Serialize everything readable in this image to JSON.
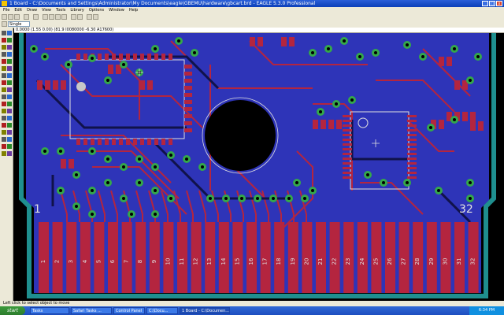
{
  "window": {
    "title": "1 Board - C:\\Documents and Settings\\Administrator\\My Documents\\eagle\\GBEMU\\hardware\\gbcart.brd - EAGLE 5.3.0 Professional",
    "min": "_",
    "max": "□",
    "close": "x"
  },
  "menu": [
    "File",
    "Edit",
    "Draw",
    "View",
    "Tools",
    "Library",
    "Options",
    "Window",
    "Help"
  ],
  "toolbar": {
    "layer_field": "1 Top",
    "grid_field": "Single"
  },
  "coord_readout": "0.0000 (1.55 0.00) (81.9 I0080000 -6.30 A17600)",
  "board": {
    "pad_label_left": "1",
    "pad_label_right": "32",
    "edge_pads": [
      "1",
      "2",
      "3",
      "4",
      "5",
      "6",
      "7",
      "8",
      "9",
      "10",
      "11",
      "12",
      "13",
      "14",
      "15",
      "16",
      "17",
      "18",
      "19",
      "20",
      "21",
      "22",
      "23",
      "24",
      "25",
      "26",
      "27",
      "28",
      "29",
      "30",
      "31",
      "32"
    ],
    "colors": {
      "background": "#000000",
      "top_copper": "#b4253f",
      "bottom_copper": "#2e34b8",
      "via": "#34a84a",
      "outline": "#1f8f8f",
      "silk": "#e0e0e0",
      "drill": "#000000"
    }
  },
  "status": "Left click to select object to move",
  "taskbar": {
    "start": "start",
    "tasks": [
      "Tasks",
      "Safari Tasks ...",
      "Control Panel",
      "C:\\Docu...",
      "1 Board - C:\\Documen..."
    ],
    "clock": "6:34 PM"
  }
}
